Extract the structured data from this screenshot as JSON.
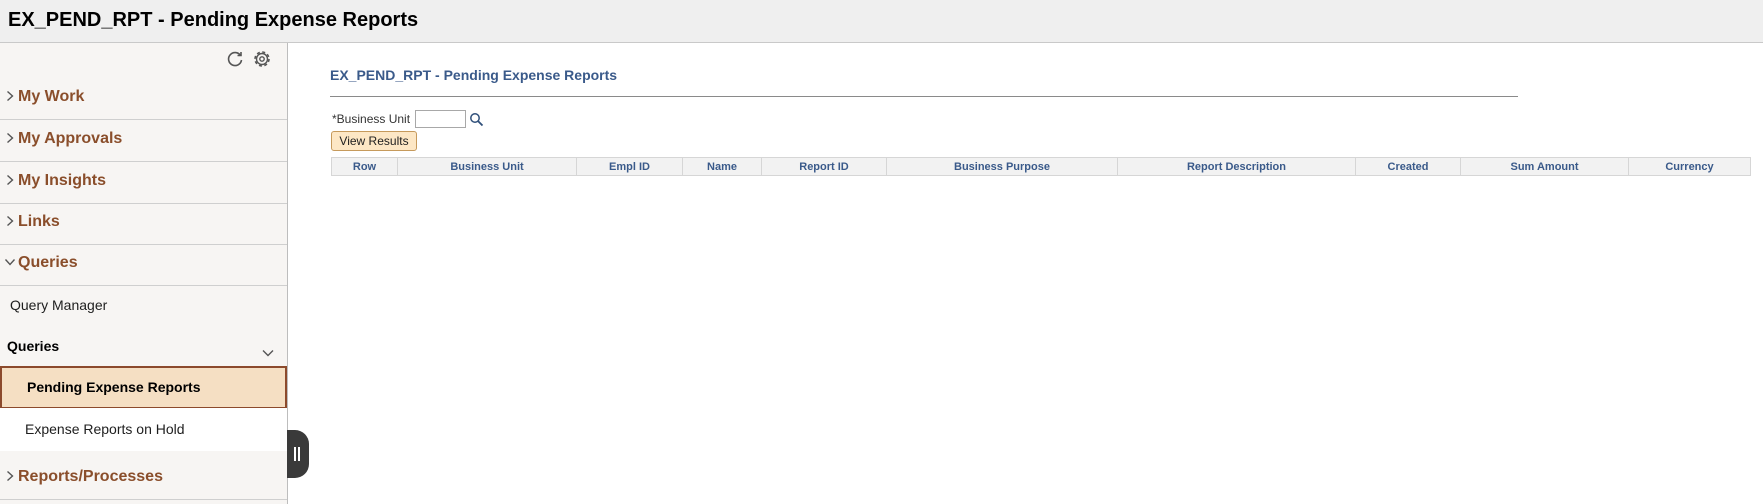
{
  "header": {
    "title": "EX_PEND_RPT - Pending Expense Reports"
  },
  "sidebar": {
    "sections": [
      {
        "label": "My Work",
        "state": "collapsed"
      },
      {
        "label": "My Approvals",
        "state": "collapsed"
      },
      {
        "label": "My Insights",
        "state": "collapsed"
      },
      {
        "label": "Links",
        "state": "collapsed"
      },
      {
        "label": "Queries",
        "state": "expanded"
      }
    ],
    "query_manager_label": "Query Manager",
    "queries_group_label": "Queries",
    "queries_items": [
      {
        "label": "Pending Expense Reports",
        "active": true
      },
      {
        "label": "Expense Reports on Hold",
        "active": false
      }
    ],
    "reports_section_label": "Reports/Processes",
    "icons": {
      "refresh": "refresh-icon",
      "settings": "gear-icon",
      "collapsed": "chevron-right-icon",
      "expanded": "chevron-down-icon"
    }
  },
  "main": {
    "title": "EX_PEND_RPT - Pending Expense Reports",
    "business_unit_label": "*Business Unit",
    "business_unit_value": "",
    "view_results_label": "View Results",
    "columns": [
      "Row",
      "Business Unit",
      "Empl ID",
      "Name",
      "Report ID",
      "Business Purpose",
      "Report Description",
      "Created",
      "Sum Amount",
      "Currency"
    ]
  },
  "colors": {
    "accent_brown": "#8a4e2b",
    "title_blue": "#3a5a8a",
    "active_bg": "#f5dfc3",
    "button_bg": "#fde7c5"
  }
}
